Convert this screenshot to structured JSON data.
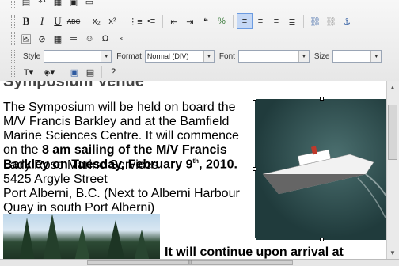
{
  "toolbar": {
    "style_label": "Style",
    "style_value": "",
    "format_label": "Format",
    "format_value": "Normal (DIV)",
    "font_label": "Font",
    "font_value": "",
    "size_label": "Size",
    "size_value": ""
  },
  "editor": {
    "heading": "Symposium Venue",
    "para1_a": "The Symposium will be held on board the M/V Francis Barkley and at the Bamfield Marine Sciences Centre. It will commence on the ",
    "para1_b": "8 am sailing of the M/V Francis Barkley on Tuesday, February 9",
    "para1_sup": "th",
    "para1_c": ", 2010.",
    "addr1": "Lady Rose Marine Services",
    "addr2": "5425 Argyle Street",
    "addr3": "Port Alberni, B.C. (Next to Alberni Harbour Quay in south Port Alberni)",
    "para2": "It will continue upon arrival at Bamfield Marine"
  },
  "scroll": {
    "hthumb_label": "III"
  }
}
